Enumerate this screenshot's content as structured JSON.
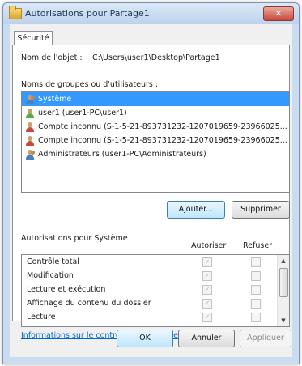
{
  "window": {
    "title": "Autorisations pour Partage1",
    "close_glyph": "✕"
  },
  "tab": {
    "label": "Sécurité"
  },
  "object": {
    "label": "Nom de l'objet :",
    "value": "C:\\Users\\user1\\Desktop\\Partage1"
  },
  "groups": {
    "label": "Noms de groupes ou d'utilisateurs :",
    "items": [
      {
        "label": "Système",
        "icon": "group-users-icon"
      },
      {
        "label": "user1 (user1-PC\\user1)",
        "icon": "user-icon"
      },
      {
        "label": "Compte inconnu (S-1-5-21-893731232-1207019659-23966025...",
        "icon": "unknown-account-icon"
      },
      {
        "label": "Compte inconnu (S-1-5-21-893731232-1207019659-23966025...",
        "icon": "unknown-account-icon"
      },
      {
        "label": "Administrateurs (user1-PC\\Administrateurs)",
        "icon": "group-users-icon"
      }
    ],
    "selected_index": 0
  },
  "buttons": {
    "add": "Ajouter...",
    "remove": "Supprimer",
    "ok": "OK",
    "cancel": "Annuler",
    "apply": "Appliquer"
  },
  "permissions": {
    "label": "Autorisations pour Système",
    "allow_header": "Autoriser",
    "deny_header": "Refuser",
    "check_glyph": "✓",
    "rows": [
      {
        "name": "Contrôle total",
        "allow": true,
        "deny": false
      },
      {
        "name": "Modification",
        "allow": true,
        "deny": false
      },
      {
        "name": "Lecture et exécution",
        "allow": true,
        "deny": false
      },
      {
        "name": "Affichage du contenu du dossier",
        "allow": true,
        "deny": false
      },
      {
        "name": "Lecture",
        "allow": true,
        "deny": false
      }
    ]
  },
  "help_link": "Informations sur le contrôle d'accès et les autorisations"
}
